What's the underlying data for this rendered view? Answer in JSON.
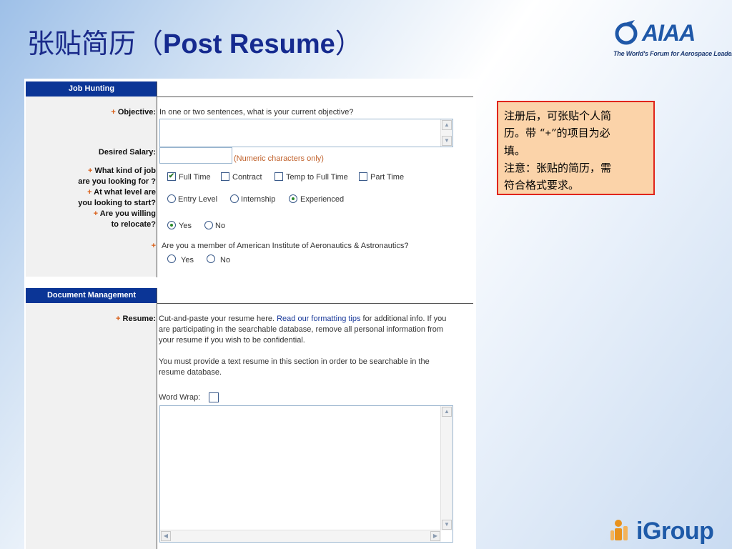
{
  "slide": {
    "title_cn": "张贴简历（",
    "title_en": "Post Resume",
    "title_close": "）"
  },
  "logo": {
    "brand": "AIAA",
    "tagline": "The World's Forum for Aerospace Leadership"
  },
  "job_hunting": {
    "header": "Job Hunting",
    "objective": {
      "label": "Objective:",
      "required": "+",
      "prompt": "In one or two sentences, what is your current objective?",
      "value": ""
    },
    "salary": {
      "label": "Desired Salary:",
      "value": "",
      "hint": "(Numeric characters only)"
    },
    "job_kind": {
      "label_line1": "What kind of job",
      "label_line2": "are you looking for ?",
      "required": "+",
      "options": [
        {
          "label": "Full Time",
          "checked": true
        },
        {
          "label": "Contract",
          "checked": false
        },
        {
          "label": "Temp to Full Time",
          "checked": false
        },
        {
          "label": "Part Time",
          "checked": false
        }
      ]
    },
    "level": {
      "label_line1": "At what level are",
      "label_line2": "you looking to start?",
      "required": "+",
      "options": [
        {
          "label": "Entry Level",
          "selected": false
        },
        {
          "label": "Internship",
          "selected": false
        },
        {
          "label": "Experienced",
          "selected": true
        }
      ]
    },
    "relocate": {
      "label_line1": "Are you willing",
      "label_line2": "to relocate?",
      "required": "+",
      "options": [
        {
          "label": "Yes",
          "selected": true
        },
        {
          "label": "No",
          "selected": false
        }
      ]
    },
    "membership": {
      "required": "+",
      "question": "Are you a member of American Institute of Aeronautics & Astronautics?",
      "options": [
        {
          "label": "Yes",
          "selected": false
        },
        {
          "label": "No",
          "selected": false
        }
      ]
    }
  },
  "document_management": {
    "header": "Document Management",
    "resume": {
      "label": "Resume:",
      "required": "+",
      "intro_before_link": "Cut-and-paste your resume here.",
      "link": "Read our formatting tips",
      "intro_line1_after": "for additional info. If you",
      "intro_line2": "are participating in the searchable database, remove all personal information from",
      "intro_line3": "your resume if you wish to be confidential.",
      "note_line1": "You must provide a text resume in this section in order to be searchable in the",
      "note_line2": "resume database.",
      "word_wrap_label": "Word Wrap:",
      "word_wrap_checked": false,
      "value": ""
    }
  },
  "note_box": {
    "line1": "注册后，可张贴个人简",
    "line2_a": "历。带 “",
    "line2_plus": "+",
    "line2_b": "”的项目为必",
    "line3": "填。",
    "line4": "注意：张贴的简历，需",
    "line5": "符合格式要求。"
  },
  "footer_logo": {
    "word": "iGroup"
  },
  "colors": {
    "header_blue": "#0b3596",
    "required_plus": "#d9601a",
    "note_border": "#e0241b",
    "note_fill": "#fbd3a9",
    "title_blue": "#1a2a8a"
  }
}
